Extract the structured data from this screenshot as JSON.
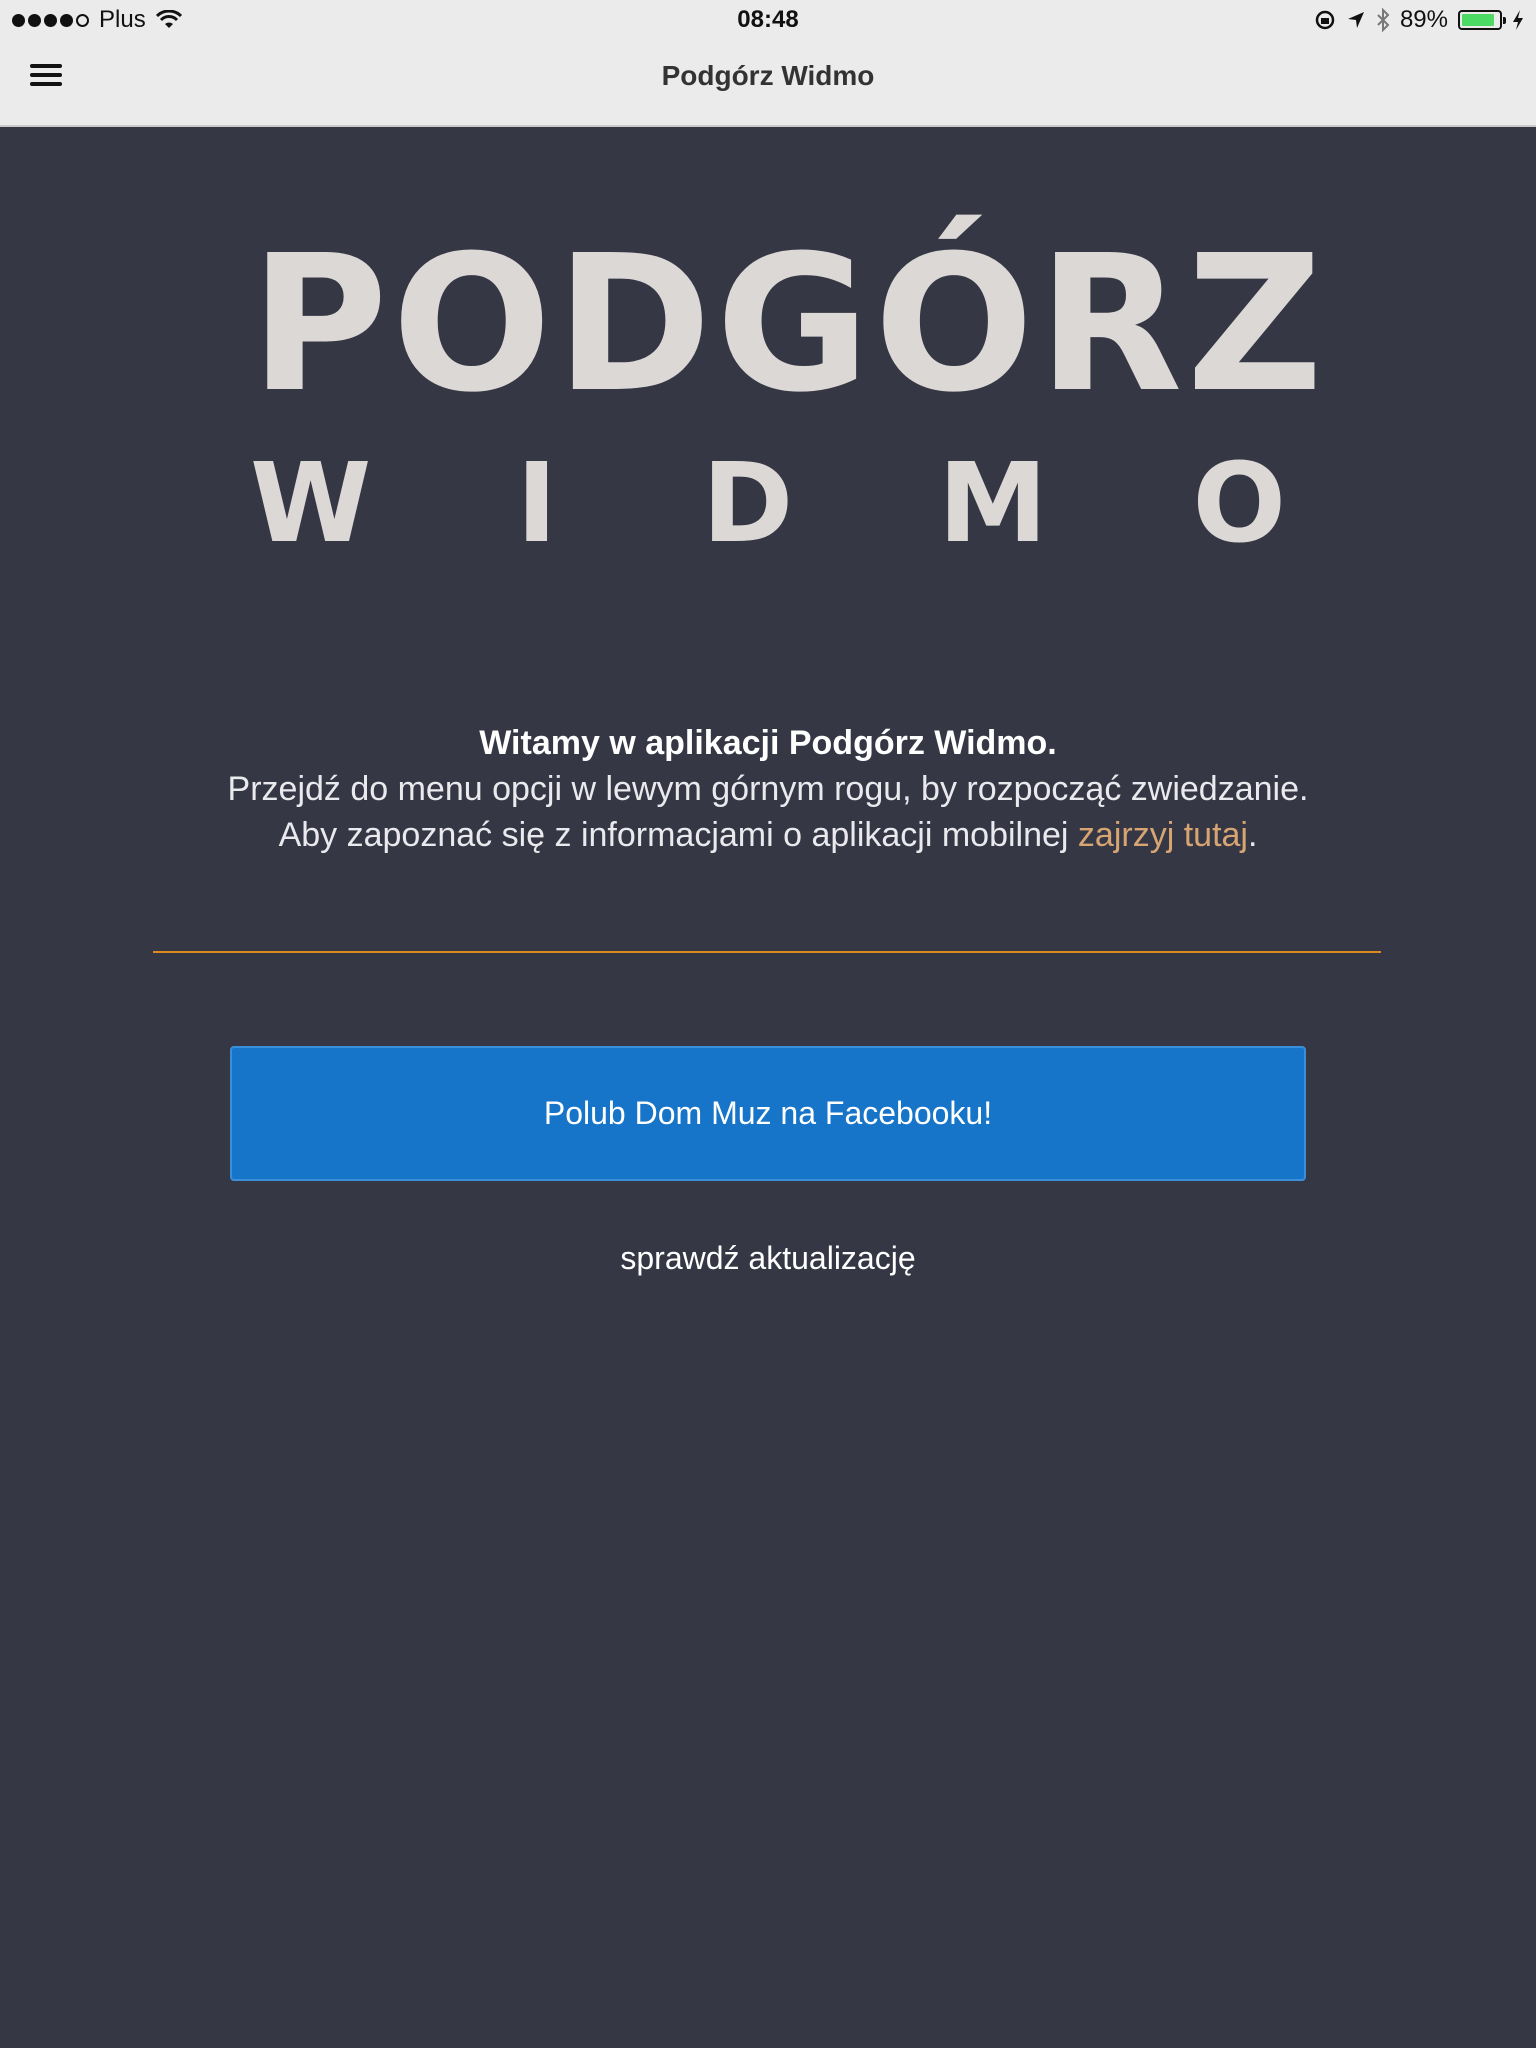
{
  "status_bar": {
    "carrier": "Plus",
    "time": "08:48",
    "battery": "89%",
    "battery_level": 0.89,
    "battery_color": "#4cd964"
  },
  "navbar": {
    "title": "Podgórz Widmo",
    "menu_icon": "hamburger-menu-icon"
  },
  "logo": {
    "line1": "PODGÓRZ",
    "line2_letters": [
      "W",
      "I",
      "D",
      "M",
      "O"
    ]
  },
  "intro": {
    "headline": "Witamy w aplikacji Podgórz Widmo.",
    "line1": "Przejdź do menu opcji w lewym górnym rogu, by rozpocząć zwiedzanie.",
    "line2_prefix": "Aby zapoznać się z informacjami o aplikacji mobilnej ",
    "line2_link": "zajrzyj tutaj",
    "line2_suffix": "."
  },
  "facebook_button": {
    "label": "Polub Dom Muz na Facebooku!"
  },
  "update_link": {
    "label": "sprawdź aktualizację"
  },
  "colors": {
    "background": "#353744",
    "accent_line": "#e08a1e",
    "link": "#d6a572",
    "facebook_button": "#1675c8"
  }
}
